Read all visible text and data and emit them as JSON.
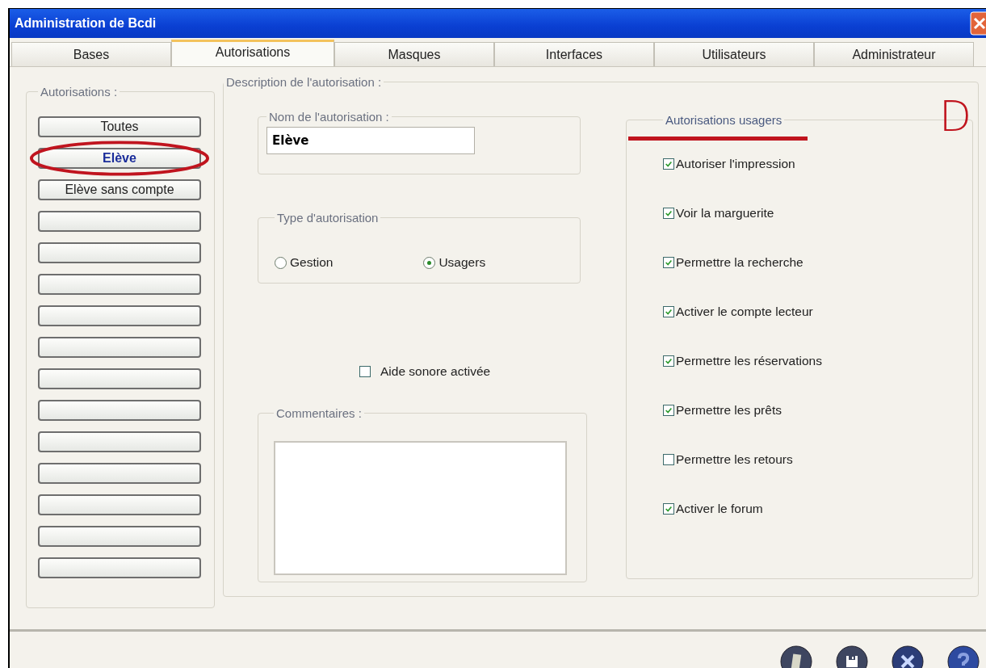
{
  "window": {
    "title": "Administration de Bcdi"
  },
  "tabs": [
    {
      "label": "Bases",
      "selected": false
    },
    {
      "label": "Autorisations",
      "selected": true
    },
    {
      "label": "Masques",
      "selected": false
    },
    {
      "label": "Interfaces",
      "selected": false
    },
    {
      "label": "Utilisateurs",
      "selected": false
    },
    {
      "label": "Administrateur",
      "selected": false
    }
  ],
  "authorizations": {
    "legend": "Autorisations :",
    "items": [
      {
        "label": "Toutes",
        "selected": false
      },
      {
        "label": "Elève",
        "selected": true
      },
      {
        "label": "Elève sans compte",
        "selected": false
      },
      {
        "selected": false
      },
      {
        "selected": false
      },
      {
        "selected": false
      },
      {
        "selected": false
      },
      {
        "selected": false
      },
      {
        "selected": false
      },
      {
        "selected": false
      },
      {
        "selected": false
      },
      {
        "selected": false
      },
      {
        "selected": false
      },
      {
        "selected": false
      },
      {
        "selected": false
      }
    ]
  },
  "description": {
    "legend": "Description de l'autorisation :",
    "name_group": {
      "legend": "Nom de l'autorisation :",
      "value": "Elève"
    },
    "type_group": {
      "legend": "Type d'autorisation",
      "options": [
        {
          "label": "Gestion",
          "selected": false
        },
        {
          "label": "Usagers",
          "selected": true
        }
      ]
    },
    "sound_help": {
      "label": "Aide sonore activée",
      "checked": false
    },
    "comments": {
      "legend": "Commentaires :"
    },
    "user_permissions": {
      "legend": "Autorisations usagers",
      "items": [
        {
          "label": "Autoriser l'impression",
          "checked": true
        },
        {
          "label": "Voir la marguerite",
          "checked": true
        },
        {
          "label": "Permettre la recherche",
          "checked": true
        },
        {
          "label": "Activer le compte lecteur",
          "checked": true
        },
        {
          "label": "Permettre les réservations",
          "checked": true
        },
        {
          "label": "Permettre les prêts",
          "checked": true
        },
        {
          "label": "Permettre les retours",
          "checked": false
        },
        {
          "label": "Activer le forum",
          "checked": true
        }
      ]
    }
  },
  "annotation": {
    "letter": "D"
  },
  "toolbar": {
    "buttons": [
      {
        "kind": "document"
      },
      {
        "kind": "save"
      },
      {
        "kind": "close"
      },
      {
        "kind": "help"
      }
    ]
  }
}
